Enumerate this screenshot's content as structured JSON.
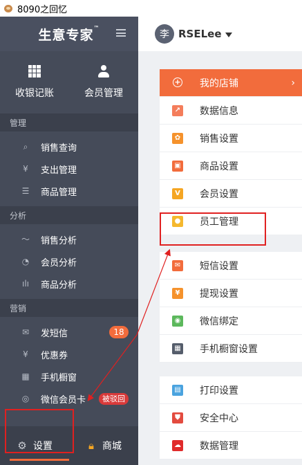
{
  "window": {
    "title": "8090之回忆"
  },
  "brand": {
    "logo": "生意专家",
    "tm": "™"
  },
  "quick": [
    {
      "label": "收银记账",
      "icon": "grid-icon"
    },
    {
      "label": "会员管理",
      "icon": "user-icon"
    }
  ],
  "sections": [
    {
      "title": "管理",
      "items": [
        {
          "label": "销售查询",
          "icon": "search-list-icon"
        },
        {
          "label": "支出管理",
          "icon": "yen-icon"
        },
        {
          "label": "商品管理",
          "icon": "box-icon"
        }
      ]
    },
    {
      "title": "分析",
      "items": [
        {
          "label": "销售分析",
          "icon": "line-chart-icon"
        },
        {
          "label": "会员分析",
          "icon": "pie-chart-icon"
        },
        {
          "label": "商品分析",
          "icon": "bar-chart-icon"
        }
      ]
    },
    {
      "title": "营销",
      "items": [
        {
          "label": "发短信",
          "icon": "envelope-icon",
          "badge": "18"
        },
        {
          "label": "优惠券",
          "icon": "coupon-icon"
        },
        {
          "label": "手机橱窗",
          "icon": "qr-icon"
        },
        {
          "label": "微信会员卡",
          "icon": "wechat-icon",
          "tag": "被驳回"
        }
      ]
    }
  ],
  "bottom": [
    {
      "label": "设置",
      "icon": "gear-icon",
      "active": true
    },
    {
      "label": "商城",
      "icon": "shopping-bag-icon"
    }
  ],
  "topbar": {
    "avatar_text": "李",
    "user": "RSELee"
  },
  "menu_groups": [
    [
      {
        "label": "我的店铺",
        "icon": "plus-circle-icon",
        "color": "#f26c3c",
        "highlight": true
      },
      {
        "label": "数据信息",
        "icon": "chart-icon",
        "color": "#f47d5b"
      },
      {
        "label": "销售设置",
        "icon": "gear-icon",
        "color": "#f5922c"
      },
      {
        "label": "商品设置",
        "icon": "gift-icon",
        "color": "#f26c3c"
      },
      {
        "label": "会员设置",
        "icon": "v-icon",
        "color": "#f5a623",
        "glyph": "V"
      },
      {
        "label": "员工管理",
        "icon": "person-icon",
        "color": "#f5b82e"
      }
    ],
    [
      {
        "label": "短信设置",
        "icon": "envelope-icon",
        "color": "#f26c3c"
      },
      {
        "label": "提现设置",
        "icon": "yen-icon",
        "color": "#f5922c",
        "glyph": "¥"
      },
      {
        "label": "微信绑定",
        "icon": "wechat-icon",
        "color": "#5cb85c"
      },
      {
        "label": "手机橱窗设置",
        "icon": "qr-icon",
        "color": "#555d6b"
      }
    ],
    [
      {
        "label": "打印设置",
        "icon": "printer-icon",
        "color": "#4aa3df"
      },
      {
        "label": "安全中心",
        "icon": "shield-icon",
        "color": "#e34b3f"
      },
      {
        "label": "数据管理",
        "icon": "cloud-icon",
        "color": "#e02b2b"
      }
    ]
  ],
  "colors": {
    "sidebar": "#454b59",
    "accent": "#f26c3c",
    "annotation": "#e02020"
  }
}
